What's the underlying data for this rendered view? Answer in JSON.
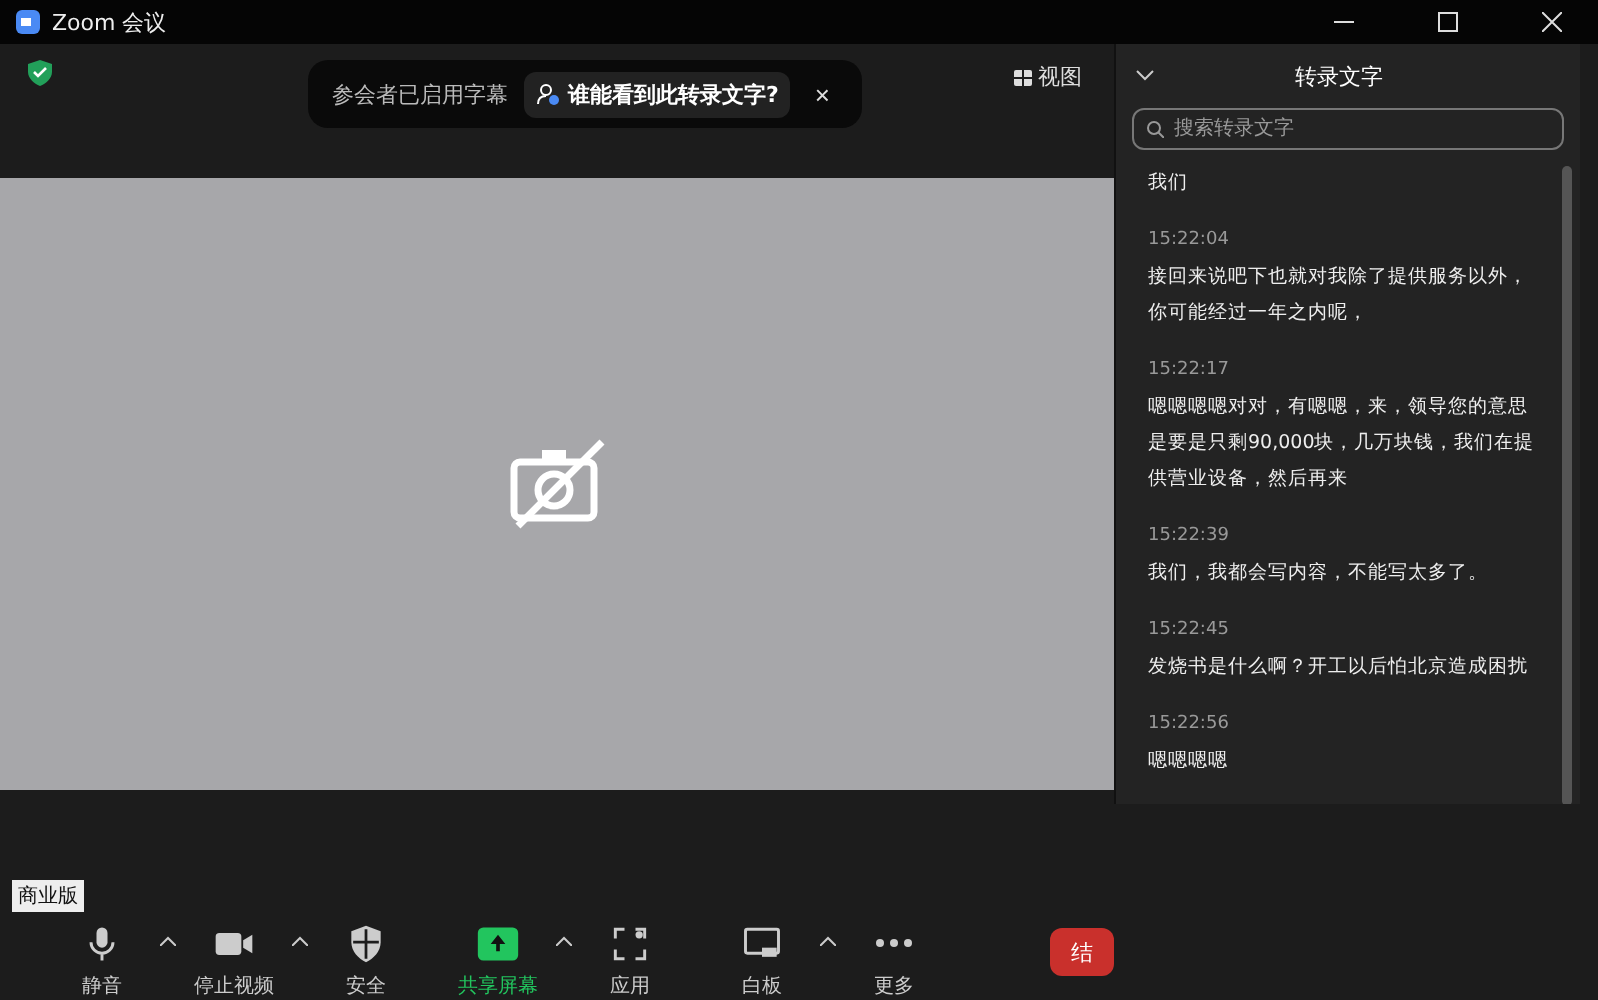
{
  "window": {
    "title": "Zoom 会议"
  },
  "banner": {
    "text": "参会者已启用字幕",
    "link": "谁能看到此转录文字?",
    "close": "×"
  },
  "view_button": "视图",
  "transcript": {
    "title": "转录文字",
    "search": {
      "placeholder": "搜索转录文字"
    },
    "entries": [
      {
        "text": "我们"
      },
      {
        "time": "15:22:04",
        "text": "接回来说吧下也就对我除了提供服务以外，你可能经过一年之内呢，"
      },
      {
        "time": "15:22:17",
        "text": "嗯嗯嗯嗯对对，有嗯嗯，来，领导您的意思是要是只剩90,000块，几万块钱，我们在提供营业设备，然后再来"
      },
      {
        "time": "15:22:39",
        "text": "我们，我都会写内容，不能写太多了。"
      },
      {
        "time": "15:22:45",
        "text": "发烧书是什么啊？开工以后怕北京造成困扰"
      },
      {
        "time": "15:22:56",
        "text": "嗯嗯嗯嗯"
      }
    ]
  },
  "tooltip": "商业版",
  "toolbar": [
    {
      "kind": "mic",
      "label": "静音",
      "caret": true,
      "selected": false
    },
    {
      "kind": "video",
      "label": "停止视频",
      "caret": true,
      "selected": false
    },
    {
      "kind": "shield",
      "label": "安全",
      "caret": false,
      "selected": false
    },
    {
      "kind": "share",
      "label": "共享屏幕",
      "caret": true,
      "selected": true
    },
    {
      "kind": "apps",
      "label": "应用",
      "caret": false,
      "selected": false
    },
    {
      "kind": "board",
      "label": "白板",
      "caret": true,
      "selected": false
    },
    {
      "kind": "more",
      "label": "更多",
      "caret": false,
      "selected": false
    }
  ],
  "end_button": "结"
}
